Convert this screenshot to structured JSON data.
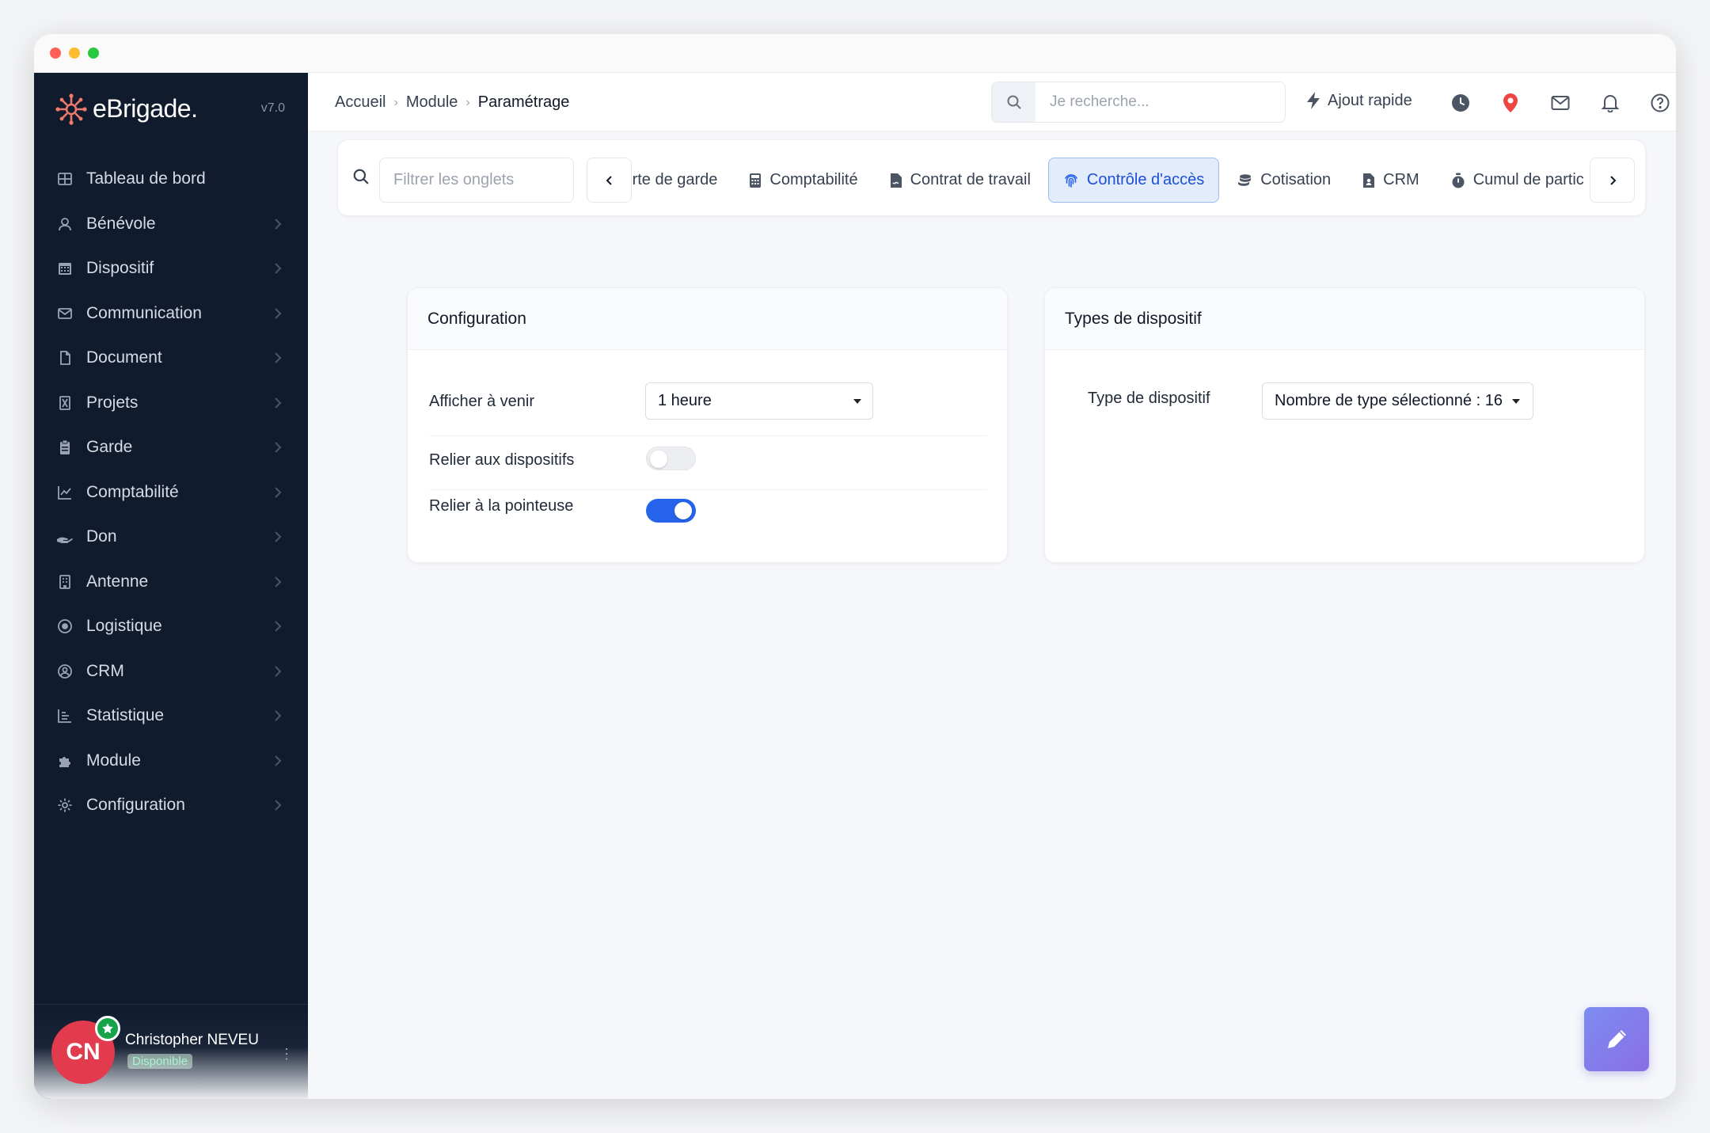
{
  "app": {
    "name": "eBrigade.",
    "version": "v7.0"
  },
  "sidebar": {
    "items": [
      {
        "label": "Tableau de bord",
        "icon": "grid-icon",
        "chevron": false
      },
      {
        "label": "Bénévole",
        "icon": "user-icon",
        "chevron": true
      },
      {
        "label": "Dispositif",
        "icon": "calendar-icon",
        "chevron": true
      },
      {
        "label": "Communication",
        "icon": "envelope-icon",
        "chevron": true
      },
      {
        "label": "Document",
        "icon": "file-icon",
        "chevron": true
      },
      {
        "label": "Projets",
        "icon": "hourglass-icon",
        "chevron": true
      },
      {
        "label": "Garde",
        "icon": "clipboard-icon",
        "chevron": true
      },
      {
        "label": "Comptabilité",
        "icon": "line-chart-icon",
        "chevron": true
      },
      {
        "label": "Don",
        "icon": "hand-holding-icon",
        "chevron": true
      },
      {
        "label": "Antenne",
        "icon": "building-icon",
        "chevron": true
      },
      {
        "label": "Logistique",
        "icon": "target-icon",
        "chevron": true
      },
      {
        "label": "CRM",
        "icon": "user-circle-icon",
        "chevron": true
      },
      {
        "label": "Statistique",
        "icon": "bar-chart-icon",
        "chevron": true
      },
      {
        "label": "Module",
        "icon": "puzzle-icon",
        "chevron": true
      },
      {
        "label": "Configuration",
        "icon": "gear-icon",
        "chevron": true
      }
    ],
    "user": {
      "initials": "CN",
      "name": "Christopher NEVEU",
      "status": "Disponible"
    }
  },
  "topbar": {
    "breadcrumb": [
      "Accueil",
      "Module",
      "Paramétrage"
    ],
    "search_placeholder": "Je recherche...",
    "quick_add_label": "Ajout rapide",
    "icons": [
      "clock-icon",
      "map-pin-icon",
      "envelope-icon",
      "bell-icon",
      "help-icon"
    ]
  },
  "tabs": {
    "filter_placeholder": "Filtrer les onglets",
    "items": [
      {
        "label": "Carte de garde",
        "icon": "card-icon",
        "active": false
      },
      {
        "label": "Comptabilité",
        "icon": "calculator-icon",
        "active": false
      },
      {
        "label": "Contrat de travail",
        "icon": "file-contract-icon",
        "active": false
      },
      {
        "label": "Contrôle d'accès",
        "icon": "fingerprint-icon",
        "active": true
      },
      {
        "label": "Cotisation",
        "icon": "coins-icon",
        "active": false
      },
      {
        "label": "CRM",
        "icon": "file-user-icon",
        "active": false
      },
      {
        "label": "Cumul de participation",
        "icon": "stopwatch-icon",
        "active": false
      }
    ]
  },
  "config_card": {
    "title": "Configuration",
    "show_upcoming_label": "Afficher à venir",
    "show_upcoming_value": "1 heure",
    "link_devices_label": "Relier aux dispositifs",
    "link_devices_on": false,
    "link_clock_label": "Relier à la pointeuse",
    "link_clock_on": true
  },
  "types_card": {
    "title": "Types de dispositif",
    "type_label": "Type de dispositif",
    "type_value": "Nombre de type sélectionné : 16"
  },
  "colors": {
    "sidebar_bg": "#111b2e",
    "accent": "#2563eb",
    "avatar": "#e23b4e",
    "status_green": "#16a34a",
    "map_pin": "#ef4444"
  }
}
